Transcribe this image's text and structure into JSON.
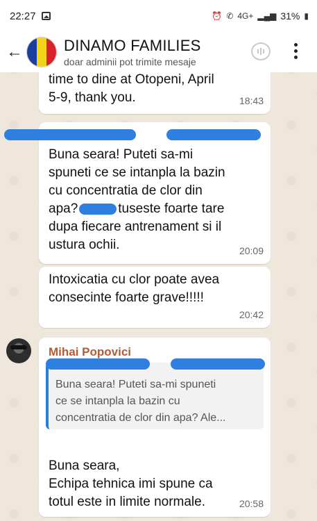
{
  "status_bar": {
    "time": "22:27",
    "network": "4G+",
    "battery": "31%"
  },
  "header": {
    "title": "DINAMO FAMILIES",
    "subtitle": "doar adminii pot trimite mesaje"
  },
  "messages": [
    {
      "text": "time to dine at Otopeni, April\n5-9, thank you.",
      "time": "18:43"
    },
    {
      "text_line1": "Buna seara! Puteti sa-mi",
      "text_line2": "spuneti ce se intanpla la bazin",
      "text_line3": "cu concentratia de clor din",
      "text_line4a": "apa?",
      "text_line4b": "tuseste foarte tare",
      "text_line5": "dupa fiecare antrenament si il",
      "text_line6": "ustura ochii.",
      "time": "20:09"
    },
    {
      "text": "Intoxicatia cu clor poate avea\nconsecinte foarte grave!!!!!",
      "time": "20:42"
    },
    {
      "sender": "Mihai Popovici",
      "quote": "Buna seara! Puteti sa-mi spuneti\nce se intanpla la bazin cu\nconcentratia de clor din apa? Ale...",
      "text": "Buna seara,\nEchipa tehnica imi spune ca\ntotul este in limite normale.",
      "time": "20:58"
    }
  ],
  "colors": {
    "redaction": "#2f7fe0",
    "sender_name": "#b45a35",
    "quote_bar": "#2a7fd4"
  }
}
